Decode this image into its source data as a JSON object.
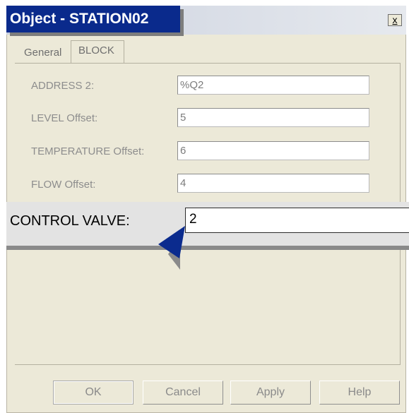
{
  "window": {
    "title": "Object - STATION02",
    "close_label": "x"
  },
  "tabs": [
    {
      "label": "General"
    },
    {
      "label": "BLOCK",
      "selected": true
    }
  ],
  "fields": [
    {
      "label": "ADDRESS 2:",
      "value": "%Q2"
    },
    {
      "label": "LEVEL Offset:",
      "value": "5"
    },
    {
      "label": "TEMPERATURE Offset:",
      "value": "6"
    },
    {
      "label": "FLOW Offset:",
      "value": "4"
    }
  ],
  "callout": {
    "label": "CONTROL VALVE:",
    "value": "2"
  },
  "buttons": {
    "ok": "OK",
    "cancel": "Cancel",
    "apply": "Apply",
    "help": "Help"
  },
  "colors": {
    "title_bar": "#0a2a8c",
    "pointer": "#0b2b8e",
    "dialog_bg": "#ece9d8"
  },
  "icons": {
    "close": "close-icon",
    "pointer": "arrow-pointer-icon"
  }
}
